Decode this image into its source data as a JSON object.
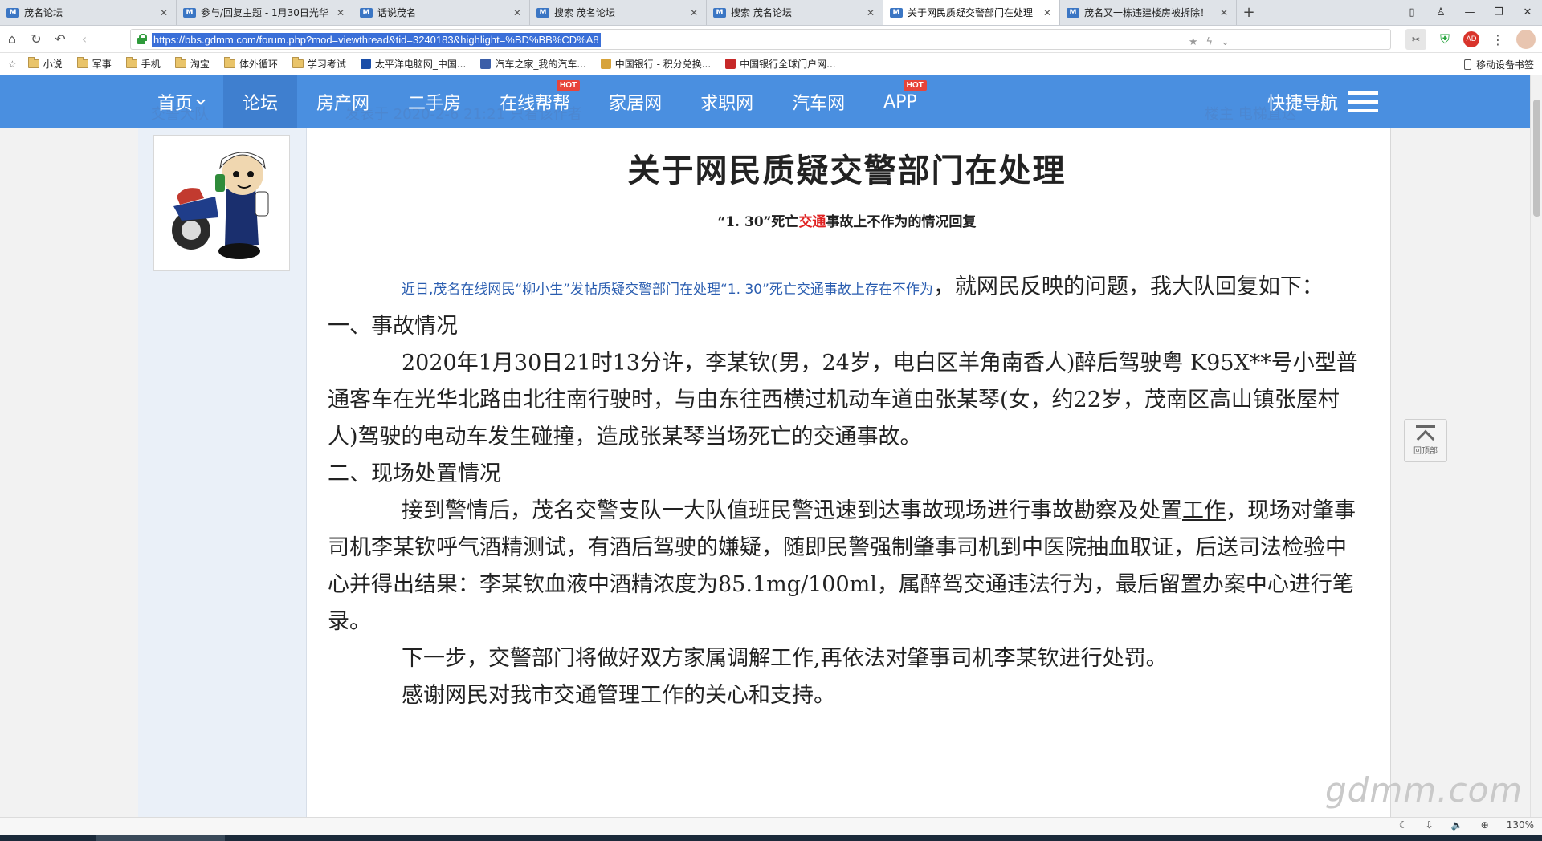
{
  "browser": {
    "tabs": [
      {
        "label": "茂名论坛",
        "active": false
      },
      {
        "label": "参与/回复主题 - 1月30日光华",
        "active": false
      },
      {
        "label": "话说茂名",
        "active": false
      },
      {
        "label": "搜索 茂名论坛",
        "active": false
      },
      {
        "label": "搜索 茂名论坛",
        "active": false
      },
      {
        "label": "关于网民质疑交警部门在处理",
        "active": true
      },
      {
        "label": "茂名又一栋违建楼房被拆除！",
        "active": false
      }
    ],
    "url": "https://bbs.gdmm.com/forum.php?mod=viewthread&tid=3240183&highlight=%BD%BB%CD%A8",
    "zoom": "130%",
    "bookmarks": [
      {
        "label": "小说",
        "type": "folder"
      },
      {
        "label": "军事",
        "type": "folder"
      },
      {
        "label": "手机",
        "type": "folder"
      },
      {
        "label": "淘宝",
        "type": "folder"
      },
      {
        "label": "体外循环",
        "type": "folder"
      },
      {
        "label": "学习考试",
        "type": "folder"
      },
      {
        "label": "太平洋电脑网_中国...",
        "type": "site"
      },
      {
        "label": "汽车之家_我的汽车...",
        "type": "site"
      },
      {
        "label": "中国银行 - 积分兑换...",
        "type": "site"
      },
      {
        "label": "中国银行全球门户网...",
        "type": "site"
      }
    ],
    "mobile_bookmarks": "移动设备书签"
  },
  "site": {
    "nav": [
      {
        "label": "首页",
        "dropdown": true,
        "active": false,
        "hot": false
      },
      {
        "label": "论坛",
        "dropdown": false,
        "active": true,
        "hot": false
      },
      {
        "label": "房产网",
        "dropdown": false,
        "active": false,
        "hot": false
      },
      {
        "label": "二手房",
        "dropdown": false,
        "active": false,
        "hot": false
      },
      {
        "label": "在线帮帮",
        "dropdown": false,
        "active": false,
        "hot": true
      },
      {
        "label": "家居网",
        "dropdown": false,
        "active": false,
        "hot": false
      },
      {
        "label": "求职网",
        "dropdown": false,
        "active": false,
        "hot": false
      },
      {
        "label": "汽车网",
        "dropdown": false,
        "active": false,
        "hot": false
      },
      {
        "label": "APP",
        "dropdown": false,
        "active": false,
        "hot": true
      }
    ],
    "hot_badge": "HOT",
    "quick_nav": "快捷导航",
    "ghost_left": "交警大队",
    "ghost_mid": "发表于 2020-2-6 21:21  只看该作者",
    "ghost_right": "楼主  电梯直达"
  },
  "post": {
    "title": "关于网民质疑交警部门在处理",
    "subtitle_pre": "“1. 30”死亡",
    "subtitle_red": "交通",
    "subtitle_post": "事故上不作为的情况回复",
    "lead_link": "近日,茂名在线网民“柳小生”发帖质疑交警部门在处理“1. 30”死亡交通事故上存在不作为",
    "lead_rest": "，就网民反映的问题，我大队回复如下：",
    "section1": "一、事故情况",
    "para1": "2020年1月30日21时13分许，李某钦(男，24岁，电白区羊角南香人)醉后驾驶粤 K95X**号小型普通客车在光华北路由北往南行驶时，与由东往西横过机动车道由张某琴(女，约22岁，茂南区高山镇张屋村人)驾驶的电动车发生碰撞，造成张某琴当场死亡的交通事故。",
    "section2": "二、现场处置情况",
    "para2_a": "接到警情后，茂名交警支队一大队值班民警迅速到达事故现场进行事故勘察及处置",
    "para2_link": "工作",
    "para2_b": "，现场对肇事司机李某钦呼气酒精测试，有酒后驾驶的嫌疑，随即民警强制肇事司机到中医院抽血取证，后送司法检验中心并得出结果：李某钦血液中酒精浓度为85.1mg/100ml，属醉驾交通违法行为，最后留置办案中心进行笔录。",
    "para3": "下一步，交警部门将做好双方家属调解工作,再依法对肇事司机李某钦进行处罚。",
    "para4": "感谢网民对我市交通管理工作的关心和支持。"
  },
  "back_to_top": "回顶部",
  "watermark": "gdmm.com"
}
